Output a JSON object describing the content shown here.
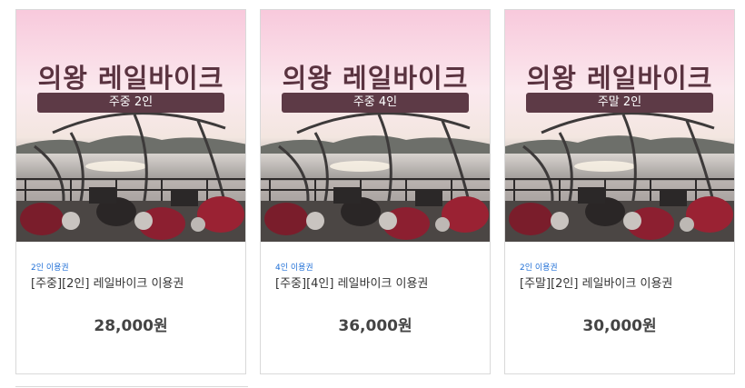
{
  "products": [
    {
      "image_title": "의왕 레일바이크",
      "image_badge": "주중 2인",
      "category": "2인 이용권",
      "name": "[주중][2인] 레일바이크 이용권",
      "price": "28,000원"
    },
    {
      "image_title": "의왕 레일바이크",
      "image_badge": "주중 4인",
      "category": "4인 이용권",
      "name": "[주중][4인] 레일바이크 이용권",
      "price": "36,000원"
    },
    {
      "image_title": "의왕 레일바이크",
      "image_badge": "주말 2인",
      "category": "2인 이용권",
      "name": "[주말][2인] 레일바이크 이용권",
      "price": "30,000원"
    }
  ],
  "colors": {
    "accent_blue": "#1f6fd6",
    "badge_bg": "#5d3a46",
    "title_text": "#5a3340",
    "card_border": "#d9d9d9"
  }
}
